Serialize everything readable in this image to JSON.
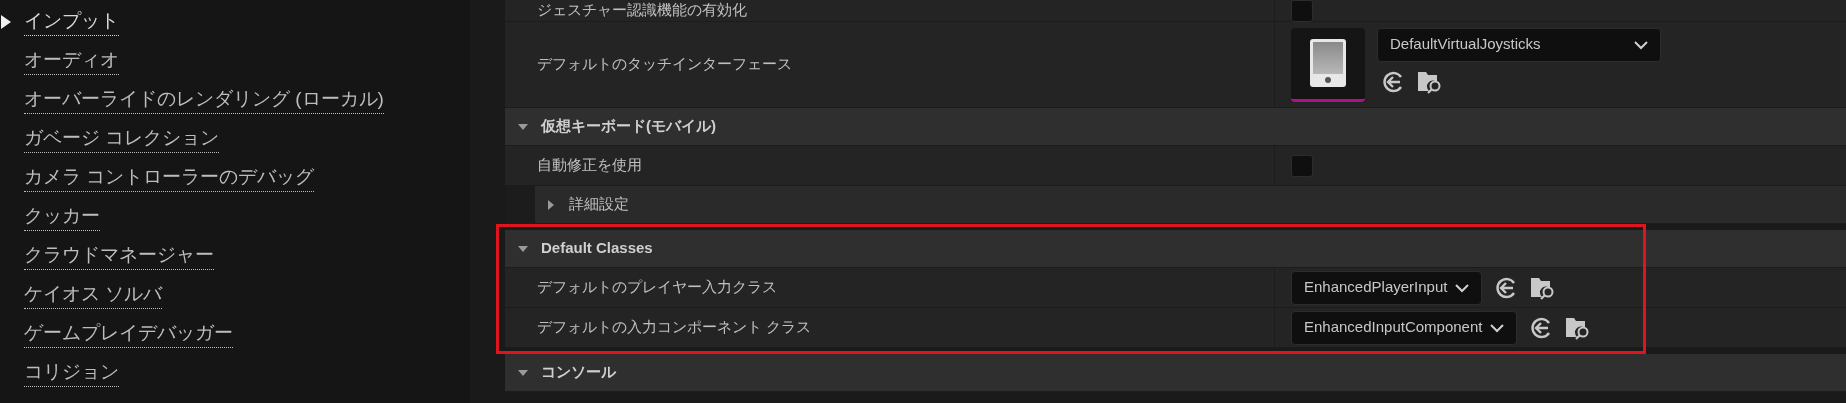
{
  "sidebar": {
    "items": [
      {
        "label": "インプット",
        "selected": true
      },
      {
        "label": "オーディオ",
        "selected": false
      },
      {
        "label": "オーバーライドのレンダリング (ローカル)",
        "selected": false
      },
      {
        "label": "ガベージ コレクション",
        "selected": false
      },
      {
        "label": "カメラ コントローラーのデバッグ",
        "selected": false
      },
      {
        "label": "クッカー",
        "selected": false
      },
      {
        "label": "クラウドマネージャー",
        "selected": false
      },
      {
        "label": "ケイオス ソルバ",
        "selected": false
      },
      {
        "label": "ゲームプレイデバッガー",
        "selected": false
      },
      {
        "label": "コリジョン",
        "selected": false
      }
    ]
  },
  "groups": [
    {
      "highlighted": false,
      "rows": [
        {
          "kind": "checkbox",
          "label": "ジェスチャー認識機能の有効化",
          "checked": false
        },
        {
          "kind": "touch",
          "label": "デフォルトのタッチインターフェース",
          "value": "DefaultVirtualJoysticks"
        },
        {
          "kind": "category",
          "label": "仮想キーボード(モバイル)",
          "expanded": true
        },
        {
          "kind": "checkbox",
          "label": "自動修正を使用",
          "checked": false
        },
        {
          "kind": "subcategory",
          "label": "詳細設定",
          "expanded": false
        }
      ]
    },
    {
      "highlighted": true,
      "rows": [
        {
          "kind": "category",
          "label": "Default Classes",
          "expanded": true
        },
        {
          "kind": "dropdown",
          "label": "デフォルトのプレイヤー入力クラス",
          "value": "EnhancedPlayerInput"
        },
        {
          "kind": "dropdown",
          "label": "デフォルトの入力コンポーネント クラス",
          "value": "EnhancedInputComponent"
        }
      ]
    },
    {
      "highlighted": false,
      "rows": [
        {
          "kind": "category",
          "label": "コンソール",
          "expanded": true
        }
      ]
    }
  ]
}
